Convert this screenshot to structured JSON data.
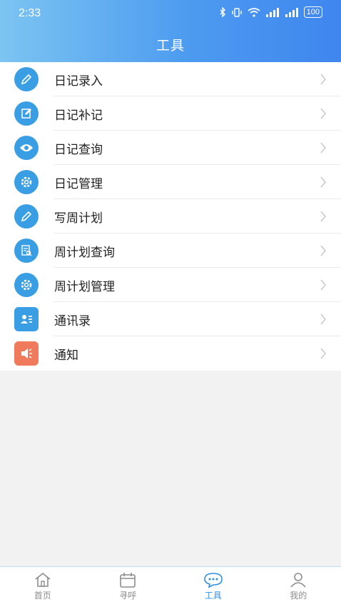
{
  "status_bar": {
    "time": "2:33",
    "battery": "100"
  },
  "header": {
    "title": "工具"
  },
  "menu": [
    {
      "label": "日记录入",
      "icon": "pencil-icon"
    },
    {
      "label": "日记补记",
      "icon": "edit-note-icon"
    },
    {
      "label": "日记查询",
      "icon": "eye-icon"
    },
    {
      "label": "日记管理",
      "icon": "gear-icon"
    },
    {
      "label": "写周计划",
      "icon": "pencil-icon"
    },
    {
      "label": "周计划查询",
      "icon": "document-search-icon"
    },
    {
      "label": "周计划管理",
      "icon": "gear-icon"
    },
    {
      "label": "通讯录",
      "icon": "contacts-icon"
    },
    {
      "label": "通知",
      "icon": "megaphone-icon"
    }
  ],
  "tabbar": {
    "items": [
      {
        "label": "首页",
        "icon": "home-icon"
      },
      {
        "label": "寻呼",
        "icon": "calendar-icon"
      },
      {
        "label": "工具",
        "icon": "chat-icon",
        "active": true
      },
      {
        "label": "我的",
        "icon": "person-icon"
      }
    ]
  },
  "colors": {
    "accent": "#2e8fe6",
    "header_start": "#7cc4f2",
    "header_end": "#3f86ef",
    "notice_icon": "#ef7b5c"
  }
}
